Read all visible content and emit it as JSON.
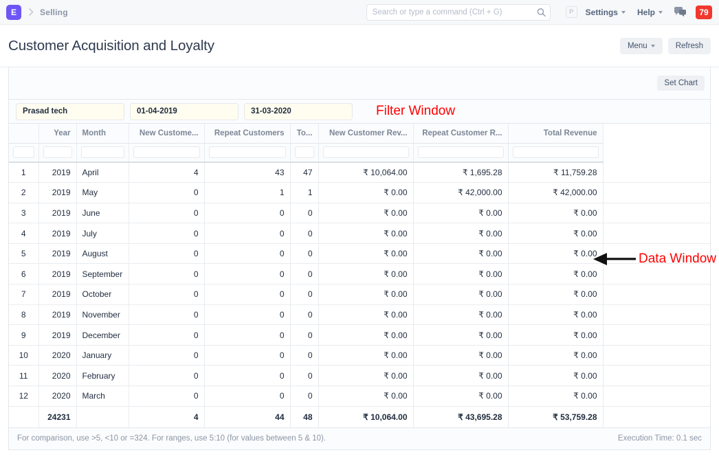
{
  "navbar": {
    "logo_letter": "E",
    "breadcrumb": "Selling",
    "search": {
      "placeholder": "Search or type a command (Ctrl + G)",
      "value": ""
    },
    "avatar_letter": "P",
    "settings_label": "Settings",
    "help_label": "Help",
    "notification_count": "79",
    "notification_color": "#f0382f",
    "logo_color": "#6d56f5"
  },
  "page": {
    "title": "Customer Acquisition and Loyalty",
    "menu_label": "Menu",
    "refresh_label": "Refresh",
    "set_chart_label": "Set Chart"
  },
  "filters": {
    "company": "Prasad tech",
    "from_date": "01-04-2019",
    "to_date": "31-03-2020"
  },
  "annotations": {
    "filter_window": "Filter Window",
    "data_window": "Data Window",
    "color": "#ff0000"
  },
  "table": {
    "columns": [
      {
        "label": "",
        "align": "center",
        "cls": "c-idx"
      },
      {
        "label": "Year",
        "align": "right",
        "cls": "c-year"
      },
      {
        "label": "Month",
        "align": "left",
        "cls": "c-mon"
      },
      {
        "label": "New Custome...",
        "align": "right",
        "cls": "c-newc"
      },
      {
        "label": "Repeat Customers",
        "align": "right",
        "cls": "c-rep"
      },
      {
        "label": "To...",
        "align": "right",
        "cls": "c-tot"
      },
      {
        "label": "New Customer Rev...",
        "align": "right",
        "cls": "c-ncr"
      },
      {
        "label": "Repeat Customer R...",
        "align": "right",
        "cls": "c-rcr"
      },
      {
        "label": "Total Revenue",
        "align": "right",
        "cls": "c-trev"
      }
    ],
    "rows": [
      {
        "idx": "1",
        "year": "2019",
        "month": "April",
        "new_customers": "4",
        "repeat_customers": "43",
        "total_customers": "47",
        "new_customer_revenue": "₹ 10,064.00",
        "repeat_customer_revenue": "₹ 1,695.28",
        "total_revenue": "₹ 11,759.28"
      },
      {
        "idx": "2",
        "year": "2019",
        "month": "May",
        "new_customers": "0",
        "repeat_customers": "1",
        "total_customers": "1",
        "new_customer_revenue": "₹ 0.00",
        "repeat_customer_revenue": "₹ 42,000.00",
        "total_revenue": "₹ 42,000.00"
      },
      {
        "idx": "3",
        "year": "2019",
        "month": "June",
        "new_customers": "0",
        "repeat_customers": "0",
        "total_customers": "0",
        "new_customer_revenue": "₹ 0.00",
        "repeat_customer_revenue": "₹ 0.00",
        "total_revenue": "₹ 0.00"
      },
      {
        "idx": "4",
        "year": "2019",
        "month": "July",
        "new_customers": "0",
        "repeat_customers": "0",
        "total_customers": "0",
        "new_customer_revenue": "₹ 0.00",
        "repeat_customer_revenue": "₹ 0.00",
        "total_revenue": "₹ 0.00"
      },
      {
        "idx": "5",
        "year": "2019",
        "month": "August",
        "new_customers": "0",
        "repeat_customers": "0",
        "total_customers": "0",
        "new_customer_revenue": "₹ 0.00",
        "repeat_customer_revenue": "₹ 0.00",
        "total_revenue": "₹ 0.00"
      },
      {
        "idx": "6",
        "year": "2019",
        "month": "September",
        "new_customers": "0",
        "repeat_customers": "0",
        "total_customers": "0",
        "new_customer_revenue": "₹ 0.00",
        "repeat_customer_revenue": "₹ 0.00",
        "total_revenue": "₹ 0.00"
      },
      {
        "idx": "7",
        "year": "2019",
        "month": "October",
        "new_customers": "0",
        "repeat_customers": "0",
        "total_customers": "0",
        "new_customer_revenue": "₹ 0.00",
        "repeat_customer_revenue": "₹ 0.00",
        "total_revenue": "₹ 0.00"
      },
      {
        "idx": "8",
        "year": "2019",
        "month": "November",
        "new_customers": "0",
        "repeat_customers": "0",
        "total_customers": "0",
        "new_customer_revenue": "₹ 0.00",
        "repeat_customer_revenue": "₹ 0.00",
        "total_revenue": "₹ 0.00"
      },
      {
        "idx": "9",
        "year": "2019",
        "month": "December",
        "new_customers": "0",
        "repeat_customers": "0",
        "total_customers": "0",
        "new_customer_revenue": "₹ 0.00",
        "repeat_customer_revenue": "₹ 0.00",
        "total_revenue": "₹ 0.00"
      },
      {
        "idx": "10",
        "year": "2020",
        "month": "January",
        "new_customers": "0",
        "repeat_customers": "0",
        "total_customers": "0",
        "new_customer_revenue": "₹ 0.00",
        "repeat_customer_revenue": "₹ 0.00",
        "total_revenue": "₹ 0.00"
      },
      {
        "idx": "11",
        "year": "2020",
        "month": "February",
        "new_customers": "0",
        "repeat_customers": "0",
        "total_customers": "0",
        "new_customer_revenue": "₹ 0.00",
        "repeat_customer_revenue": "₹ 0.00",
        "total_revenue": "₹ 0.00"
      },
      {
        "idx": "12",
        "year": "2020",
        "month": "March",
        "new_customers": "0",
        "repeat_customers": "0",
        "total_customers": "0",
        "new_customer_revenue": "₹ 0.00",
        "repeat_customer_revenue": "₹ 0.00",
        "total_revenue": "₹ 0.00"
      }
    ],
    "total_row": {
      "idx": "",
      "year": "24231",
      "month": "",
      "new_customers": "4",
      "repeat_customers": "44",
      "total_customers": "48",
      "new_customer_revenue": "₹ 10,064.00",
      "repeat_customer_revenue": "₹ 43,695.28",
      "total_revenue": "₹ 53,759.28"
    }
  },
  "footer": {
    "hint": "For comparison, use >5, <10 or =324. For ranges, use 5:10 (for values between 5 & 10).",
    "execution_time": "Execution Time: 0.1 sec"
  }
}
